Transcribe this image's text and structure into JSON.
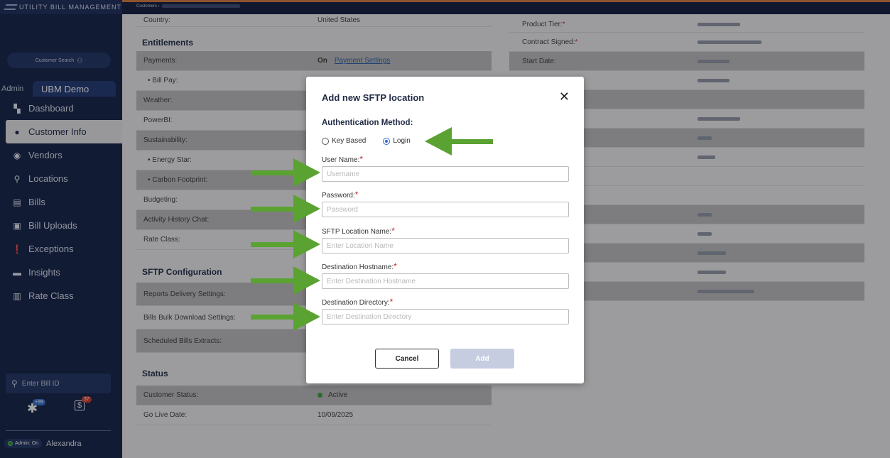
{
  "brand": {
    "name": "UTILITY BILL MANAGEMENT"
  },
  "breadcrumb": {
    "label": "Customers ›"
  },
  "sidebar": {
    "customer_search": "Customer Search",
    "admin_label": "Admin",
    "admin_selected": "UBM Demo",
    "items": [
      {
        "label": "Dashboard",
        "icon": "dashboard-icon",
        "glyph": "▚"
      },
      {
        "label": "Customer Info",
        "icon": "person-icon",
        "glyph": "●"
      },
      {
        "label": "Vendors",
        "icon": "vendor-icon",
        "glyph": "◉"
      },
      {
        "label": "Locations",
        "icon": "location-pin-icon",
        "glyph": "⚲"
      },
      {
        "label": "Bills",
        "icon": "bill-icon",
        "glyph": "▤"
      },
      {
        "label": "Bill Uploads",
        "icon": "upload-icon",
        "glyph": "▣"
      },
      {
        "label": "Exceptions",
        "icon": "exclamation-icon",
        "glyph": "❗"
      },
      {
        "label": "Insights",
        "icon": "insights-icon",
        "glyph": "▬"
      },
      {
        "label": "Rate Class",
        "icon": "rate-class-icon",
        "glyph": "▥"
      }
    ],
    "active_index": 1,
    "bill_search_placeholder": "Enter Bill ID",
    "badges": [
      {
        "icon": "asterisk-icon",
        "glyph": "✱",
        "count": "+99",
        "color": "#2f6fd1"
      },
      {
        "icon": "bill-dollar-icon",
        "glyph": "$",
        "count": "37",
        "color": "#d03b2b"
      }
    ],
    "admin_toggle": "Admin: On",
    "user_name": "Alexandra"
  },
  "main": {
    "country": {
      "label": "Country:",
      "value": "United States"
    },
    "entitlements": {
      "title": "Entitlements",
      "rows": [
        {
          "label": "Payments:",
          "value": "On",
          "link": "Payment Settings"
        },
        {
          "label": "• Bill Pay:",
          "value": ""
        },
        {
          "label": "Weather:",
          "value": ""
        },
        {
          "label": "PowerBI:",
          "value": ""
        },
        {
          "label": "Sustainability:",
          "value": ""
        },
        {
          "label": "• Energy Star:",
          "value": ""
        },
        {
          "label": "• Carbon Footprint:",
          "value": ""
        },
        {
          "label": "Budgeting:",
          "value": ""
        },
        {
          "label": "Activity History Chat:",
          "value": ""
        },
        {
          "label": "Rate Class:",
          "value": ""
        }
      ]
    },
    "sftp": {
      "title": "SFTP Configuration",
      "rows": [
        {
          "label": "Reports Delivery Settings:"
        },
        {
          "label": "Bills Bulk Download Settings:"
        },
        {
          "label": "Scheduled Bills Extracts:"
        }
      ]
    },
    "status": {
      "title": "Status",
      "rows": [
        {
          "label": "Customer Status:",
          "value": "Active"
        },
        {
          "label": "Go Live Date:",
          "value": "10/09/2025"
        }
      ]
    },
    "right": {
      "rows": [
        {
          "label": "Product Tier:",
          "required": "*"
        },
        {
          "label": "Contract Signed:",
          "required": "*"
        },
        {
          "label": "Start Date:",
          "required": ""
        }
      ]
    }
  },
  "modal": {
    "title": "Add new SFTP location",
    "close_glyph": "✕",
    "auth_title": "Authentication Method:",
    "radio_key": "Key Based",
    "radio_login": "Login",
    "selected_method": "Login",
    "fields": {
      "username": {
        "label": "User Name:",
        "required": "*",
        "placeholder": "Username"
      },
      "password": {
        "label": "Password:",
        "required": "*",
        "placeholder": "Password"
      },
      "location": {
        "label": "SFTP Location Name:",
        "required": "*",
        "placeholder": "Enter Location Name"
      },
      "hostname": {
        "label": "Destination Hostname:",
        "required": "*",
        "placeholder": "Enter Destination Hostname"
      },
      "directory": {
        "label": "Destination Directory:",
        "required": "*",
        "placeholder": "Enter Destination Directory"
      }
    },
    "cancel": "Cancel",
    "add": "Add"
  },
  "annotation": {
    "arrow_color": "#5aa232"
  }
}
